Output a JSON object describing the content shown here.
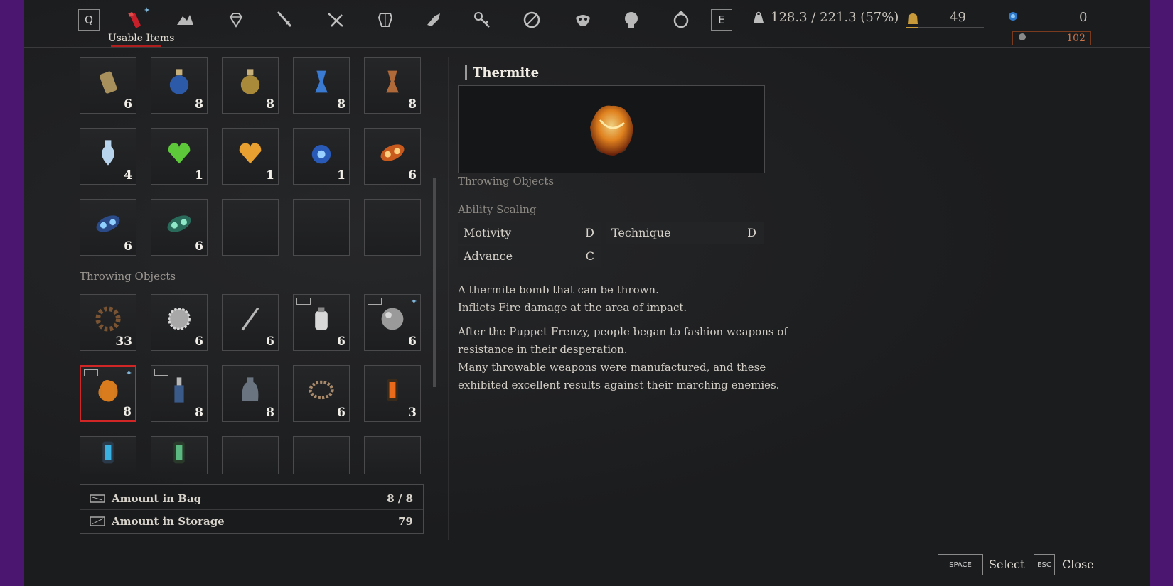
{
  "topbar": {
    "left_key": "Q",
    "right_key": "E",
    "active_tab_label": "Usable Items",
    "weight": "128.3 / 221.3 (57%)",
    "gold_count": "49",
    "ergo_count": "0",
    "secondary_currency": "102",
    "tabs": [
      "usable-items",
      "weapon-material",
      "gem",
      "dagger",
      "blade",
      "armor",
      "arm",
      "key-item",
      "disc",
      "mask",
      "head",
      "amulet"
    ]
  },
  "inventory": {
    "consumables": [
      {
        "count": "6",
        "icon": "canister"
      },
      {
        "count": "8",
        "icon": "blue-flask"
      },
      {
        "count": "8",
        "icon": "gold-flask"
      },
      {
        "count": "8",
        "icon": "blue-vial"
      },
      {
        "count": "8",
        "icon": "copper-vial"
      },
      {
        "count": "4",
        "icon": "pale-flask"
      },
      {
        "count": "1",
        "icon": "green-heart"
      },
      {
        "count": "1",
        "icon": "amber-heart"
      },
      {
        "count": "1",
        "icon": "blue-orb"
      },
      {
        "count": "6",
        "icon": "fire-cog"
      },
      {
        "count": "6",
        "icon": "blue-cog"
      },
      {
        "count": "6",
        "icon": "teal-cog"
      },
      {
        "count": "",
        "icon": "empty"
      },
      {
        "count": "",
        "icon": "empty"
      },
      {
        "count": "",
        "icon": "empty"
      }
    ],
    "section_label": "Throwing Objects",
    "throwing": [
      {
        "count": "33",
        "icon": "gear"
      },
      {
        "count": "6",
        "icon": "saw"
      },
      {
        "count": "6",
        "icon": "javelin"
      },
      {
        "count": "6",
        "icon": "flask-bomb",
        "tag": true
      },
      {
        "count": "6",
        "icon": "iron-ball",
        "tag": true,
        "diamond": true
      },
      {
        "count": "8",
        "icon": "thermite",
        "tag": true,
        "diamond": true,
        "selected": true
      },
      {
        "count": "8",
        "icon": "electric-bottle",
        "tag": true
      },
      {
        "count": "8",
        "icon": "grey-bottle"
      },
      {
        "count": "6",
        "icon": "chain"
      },
      {
        "count": "3",
        "icon": "fire-lantern"
      },
      {
        "count": "",
        "icon": "blue-lantern"
      },
      {
        "count": "",
        "icon": "green-lantern"
      },
      {
        "count": "",
        "icon": "empty"
      },
      {
        "count": "",
        "icon": "empty"
      },
      {
        "count": "",
        "icon": "empty"
      }
    ],
    "amount_in_bag_label": "Amount in Bag",
    "amount_in_bag": "8 / 8",
    "amount_in_storage_label": "Amount in Storage",
    "amount_in_storage": "79"
  },
  "detail": {
    "title": "Thermite",
    "category": "Throwing Objects",
    "scaling_label": "Ability Scaling",
    "scaling": [
      {
        "name": "Motivity",
        "grade": "D"
      },
      {
        "name": "Technique",
        "grade": "D"
      },
      {
        "name": "Advance",
        "grade": "C"
      }
    ],
    "desc1_line1": "A thermite bomb that can be thrown.",
    "desc1_line2": "Inflicts Fire damage at the area of impact.",
    "desc2_line1": "After the Puppet Frenzy, people began to fashion weapons of",
    "desc2_line2": "resistance in their desperation.",
    "desc2_line3": "Many throwable weapons were manufactured, and these",
    "desc2_line4": "exhibited excellent results against their marching enemies."
  },
  "footer": {
    "select_key": "SPACE",
    "select_label": "Select",
    "close_key": "ESC",
    "close_label": "Close"
  }
}
